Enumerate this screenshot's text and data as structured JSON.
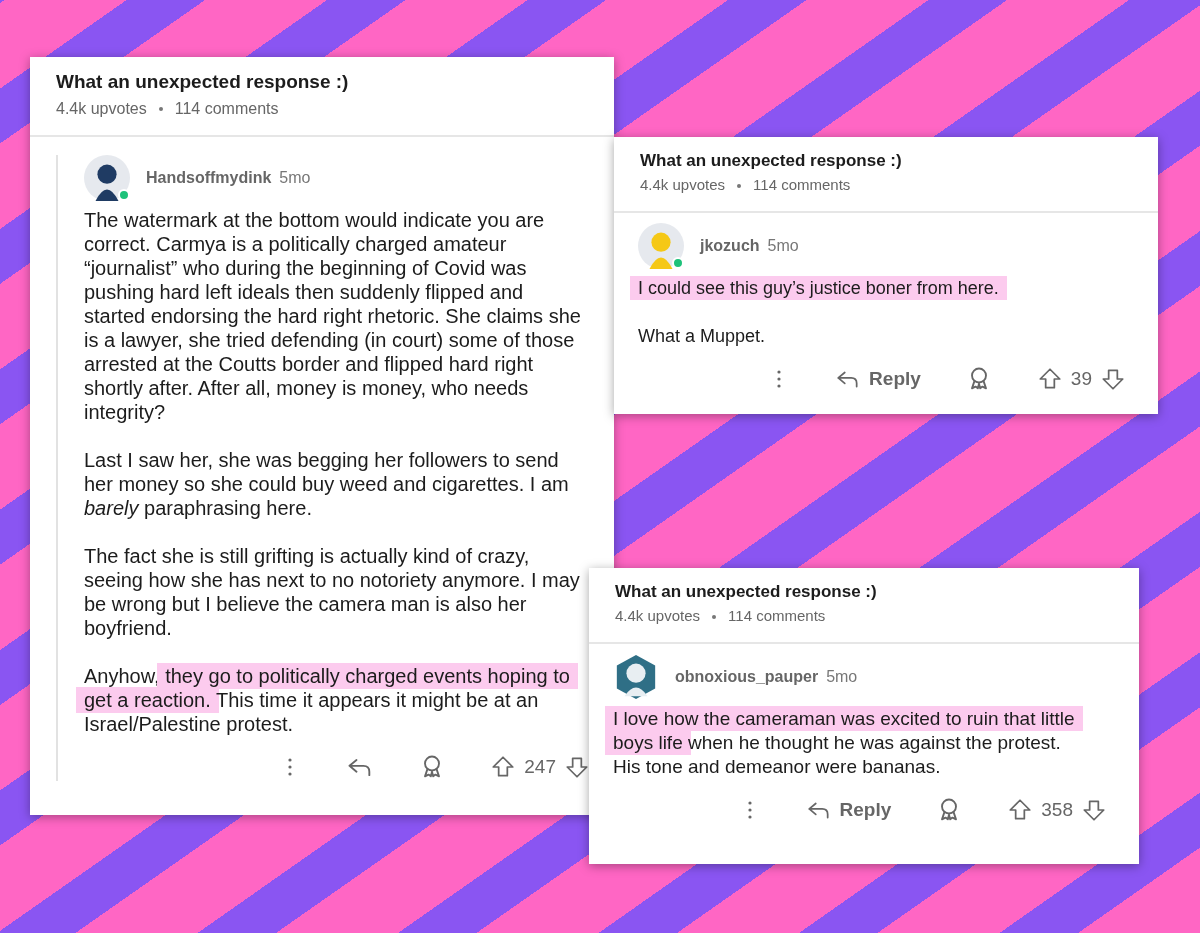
{
  "posts": [
    {
      "title": "What an unexpected response :)",
      "upvotes": "4.4k upvotes",
      "comments": "114 comments",
      "comment": {
        "author": "Handsoffmydink",
        "age": "5mo",
        "online": true,
        "threaded": true,
        "avatar": {
          "kind": "circle",
          "color": "#1f3b63"
        },
        "paragraphs": [
          [
            {
              "text": "The watermark at the bottom would indicate you are correct. Carmya is a politically charged amateur “journalist” who during the beginning of Covid was pushing hard left ideals then suddenly flipped and started endorsing the hard right rhetoric. She claims she is a lawyer, she tried defending (in court) some of those arrested at the Coutts border and flipped hard right shortly after. After all, money is money, who needs integrity?",
              "highlighted": false
            }
          ],
          [
            {
              "text": "Last I saw her, she was begging her followers to send her money so she could buy weed and cigarettes. I am *barely* paraphrasing here.",
              "highlighted": false
            }
          ],
          [
            {
              "text": "The fact she is still grifting is actually kind of crazy, seeing how she has next to no notoriety anymore. I may be wrong but I believe the camera man is also her boyfriend.",
              "highlighted": false
            }
          ],
          [
            {
              "text": "Anyhow, ",
              "highlighted": false
            },
            {
              "text": "they go to politically charged events hoping to get a reaction.",
              "highlighted": true
            },
            {
              "text": " This time it appears it might be at an Israel/Palestine protest.",
              "highlighted": false
            }
          ]
        ],
        "score": "247"
      }
    },
    {
      "title": "What an unexpected response :)",
      "upvotes": "4.4k upvotes",
      "comments": "114 comments",
      "comment": {
        "author": "jkozuch",
        "age": "5mo",
        "online": true,
        "threaded": false,
        "avatar": {
          "kind": "circle",
          "color": "#f5c816"
        },
        "paragraphs": [
          [
            {
              "text": "I could see this guy’s justice boner from here.",
              "highlighted": true
            }
          ],
          [
            {
              "text": "What a Muppet.",
              "highlighted": false
            }
          ]
        ],
        "reply_label": "Reply",
        "score": "39"
      }
    },
    {
      "title": "What an unexpected response :)",
      "upvotes": "4.4k upvotes",
      "comments": "114 comments",
      "comment": {
        "author": "obnoxious_pauper",
        "age": "5mo",
        "online": false,
        "threaded": false,
        "avatar": {
          "kind": "hexagon",
          "color": "#2f6f86"
        },
        "paragraphs": [
          [
            {
              "text": "I love how the cameraman was excited to ruin that little boys life",
              "highlighted": true
            },
            {
              "text": " when he thought he was against the protest. His tone and demeanor were bananas.",
              "highlighted": false
            }
          ]
        ],
        "reply_label": "Reply",
        "score": "358"
      }
    }
  ]
}
